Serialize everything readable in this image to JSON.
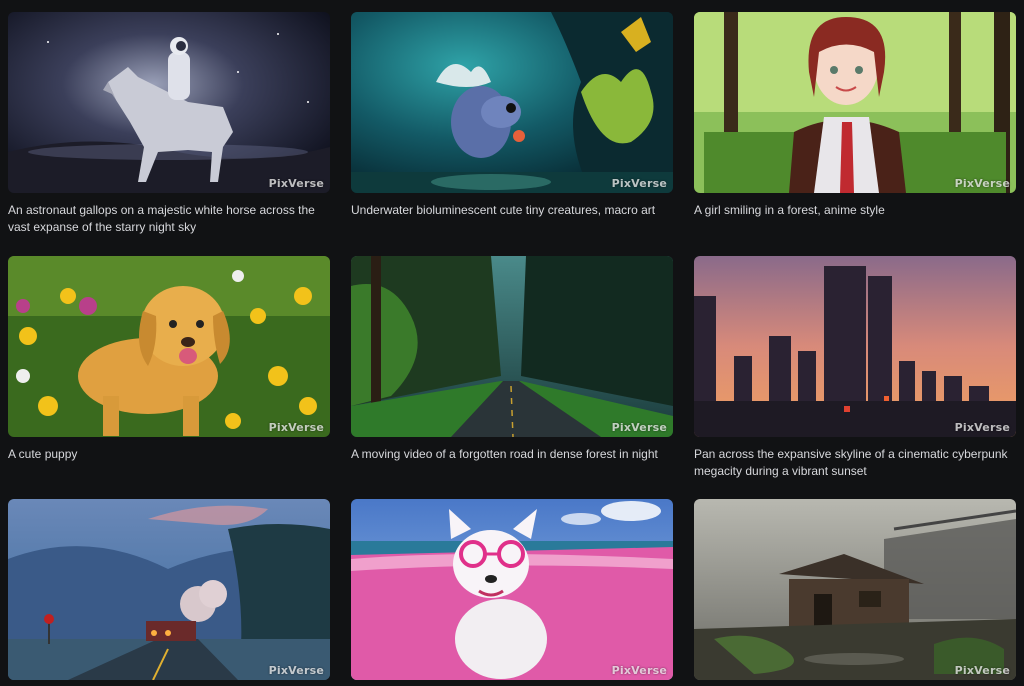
{
  "watermark": "PixVerse",
  "cards": [
    {
      "caption": "An astronaut gallops on a majestic white horse across the vast expanse of the starry night sky",
      "scene": "astronaut-horse"
    },
    {
      "caption": "Underwater bioluminescent cute tiny creatures, macro art",
      "scene": "underwater-creature"
    },
    {
      "caption": "A girl smiling in a forest, anime style",
      "scene": "anime-girl-forest"
    },
    {
      "caption": "A cute puppy",
      "scene": "puppy-flowers"
    },
    {
      "caption": "A moving video of a forgotten road in dense forest in night",
      "scene": "forest-road"
    },
    {
      "caption": "Pan across the expansive skyline of a cinematic cyberpunk megacity during a vibrant sunset",
      "scene": "city-skyline"
    },
    {
      "caption": "",
      "scene": "road-truck"
    },
    {
      "caption": "",
      "scene": "pink-beach-dog"
    },
    {
      "caption": "",
      "scene": "ruined-hut"
    }
  ]
}
